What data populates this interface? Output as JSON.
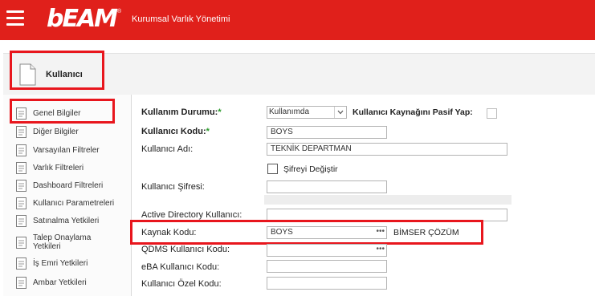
{
  "header": {
    "logo": "bEAM",
    "logo_reg": "®",
    "app_title": "Kurumsal Varlık Yönetimi"
  },
  "page": {
    "title": "Kullanıcı"
  },
  "sidebar": {
    "items": [
      {
        "label": "Genel Bilgiler"
      },
      {
        "label": "Diğer Bilgiler"
      },
      {
        "label": "Varsayılan Filtreler"
      },
      {
        "label": "Varlık Filtreleri"
      },
      {
        "label": "Dashboard Filtreleri"
      },
      {
        "label": "Kullanıcı Parametreleri"
      },
      {
        "label": "Satınalma Yetkileri"
      },
      {
        "label": "Talep Onaylama Yetkileri"
      },
      {
        "label": "İş Emri Yetkileri"
      },
      {
        "label": "Ambar Yetkileri"
      }
    ]
  },
  "form": {
    "usage_status_label": "Kullanım Durumu:",
    "required_mark": "*",
    "usage_status_value": "Kullanımda",
    "source_passive_label": "Kullanıcı Kaynağını Pasif Yap:",
    "user_code_label": "Kullanıcı Kodu:",
    "user_code_value": "BOYS",
    "user_name_label": "Kullanıcı Adı:",
    "user_name_value": "TEKNİK DEPARTMAN",
    "change_password_label": "Şifreyi Değiştir",
    "password_label": "Kullanıcı Şifresi:",
    "active_directory_label": "Active Directory Kullanıcı:",
    "source_code_label": "Kaynak Kodu:",
    "source_code_value": "BOYS",
    "source_code_dots": "•••",
    "source_code_name": "BİMSER ÇÖZÜM",
    "qdms_label": "QDMS Kullanıcı Kodu:",
    "qdms_dots": "•••",
    "eba_label": "eBA Kullanıcı Kodu:",
    "custom_code_label": "Kullanıcı Özel Kodu:"
  }
}
